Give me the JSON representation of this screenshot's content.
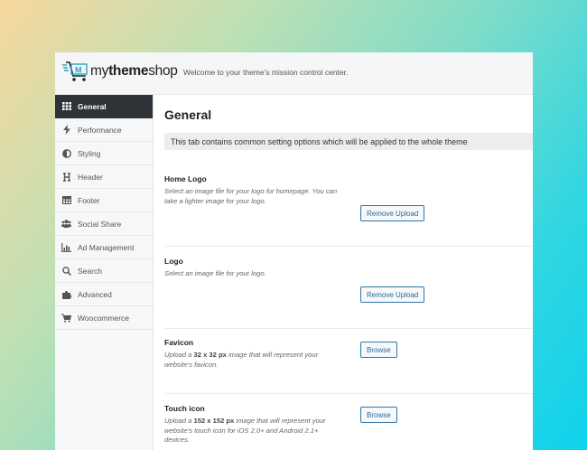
{
  "header": {
    "logo_text_prefix": "my",
    "logo_text_bold": "theme",
    "logo_text_suffix": "shop",
    "tagline": "Welcome to your theme's mission control center."
  },
  "sidebar": {
    "items": [
      {
        "label": "General",
        "icon": "grid-icon",
        "active": true
      },
      {
        "label": "Performance",
        "icon": "bolt-icon"
      },
      {
        "label": "Styling",
        "icon": "contrast-icon"
      },
      {
        "label": "Header",
        "icon": "header-icon"
      },
      {
        "label": "Footer",
        "icon": "table-icon"
      },
      {
        "label": "Social Share",
        "icon": "users-icon"
      },
      {
        "label": "Ad Management",
        "icon": "bar-chart-icon"
      },
      {
        "label": "Search",
        "icon": "search-icon"
      },
      {
        "label": "Advanced",
        "icon": "puzzle-icon"
      },
      {
        "label": "Woocommerce",
        "icon": "cart-icon"
      }
    ]
  },
  "main": {
    "title": "General",
    "notice": "This tab contains common setting options which will be applied to the whole theme",
    "options": [
      {
        "title": "Home Logo",
        "desc": "Select an image file for your logo for homepage. You can take a lighter image for your logo.",
        "button": "Remove Upload"
      },
      {
        "title": "Logo",
        "desc": "Select an image file for your logo.",
        "button": "Remove Upload"
      },
      {
        "title": "Favicon",
        "desc_pre": "Upload a ",
        "desc_bold": "32 x 32 px",
        "desc_post": " image that will represent your website's favicon.",
        "button": "Browse"
      },
      {
        "title": "Touch icon",
        "desc_pre": "Upload a ",
        "desc_bold": "152 x 152 px",
        "desc_post": " image that will represent your website's touch icon for iOS 2.0+ and Android 2.1+ devices.",
        "button": "Browse"
      }
    ]
  },
  "colors": {
    "sidebar_active_bg": "#2f3236",
    "button_border": "#2f76a6",
    "logo_accent": "#2aa3c9"
  }
}
